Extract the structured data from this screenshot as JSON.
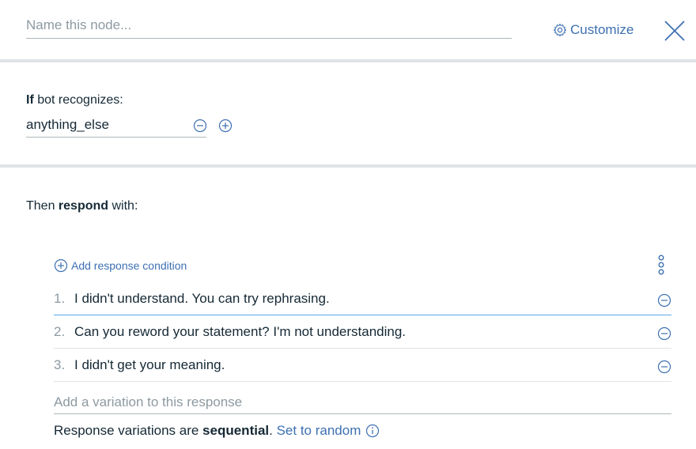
{
  "header": {
    "name_placeholder": "Name this node...",
    "customize_label": "Customize"
  },
  "condition": {
    "if_bold": "If",
    "if_rest": " bot recognizes:",
    "value": "anything_else"
  },
  "respond": {
    "then_pre": "Then ",
    "then_bold": "respond",
    "then_post": " with:",
    "add_condition_label": "Add response condition",
    "responses": [
      {
        "num": "1.",
        "text": "I didn't understand. You can try rephrasing."
      },
      {
        "num": "2.",
        "text": "Can you reword your statement? I'm not understanding."
      },
      {
        "num": "3.",
        "text": "I didn't get your meaning."
      }
    ],
    "variation_placeholder": "Add a variation to this response",
    "sequential_pre": "Response variations are ",
    "sequential_bold": "sequential",
    "sequential_post": ". ",
    "set_random_label": "Set to random"
  },
  "colors": {
    "accent": "#3d70b2",
    "active_underline": "#5aa9e6",
    "divider": "#dfe3e6",
    "placeholder": "#8d9aa1"
  },
  "icons": [
    "gear-icon",
    "close-icon",
    "minus-circle-icon",
    "plus-circle-icon",
    "overflow-menu-icon",
    "info-icon"
  ]
}
